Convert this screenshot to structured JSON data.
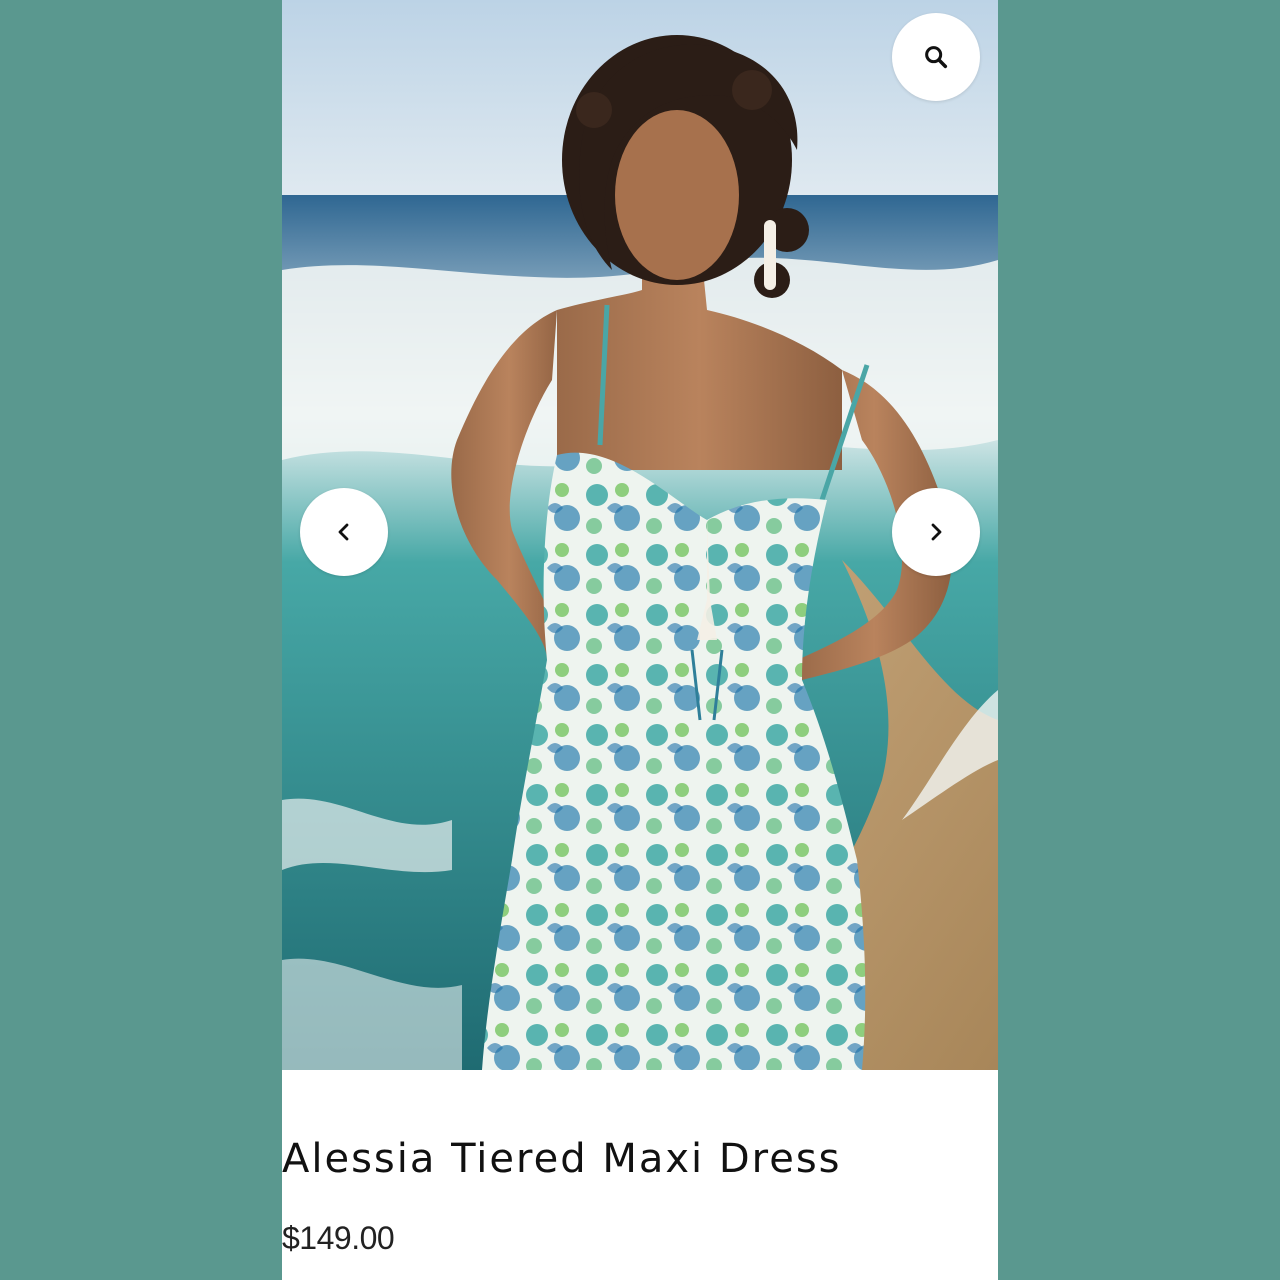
{
  "product": {
    "title": "Alessia Tiered Maxi Dress",
    "price": "$149.00",
    "image_alt": "Model wearing a blue and green floral print tiered maxi dress on a beach"
  },
  "controls": {
    "zoom_icon": "search-icon",
    "prev_icon": "chevron-left-icon",
    "next_icon": "chevron-right-icon"
  },
  "colors": {
    "background": "#5a988f",
    "card": "#ffffff",
    "title_text": "#111111",
    "price_text": "#222222"
  }
}
